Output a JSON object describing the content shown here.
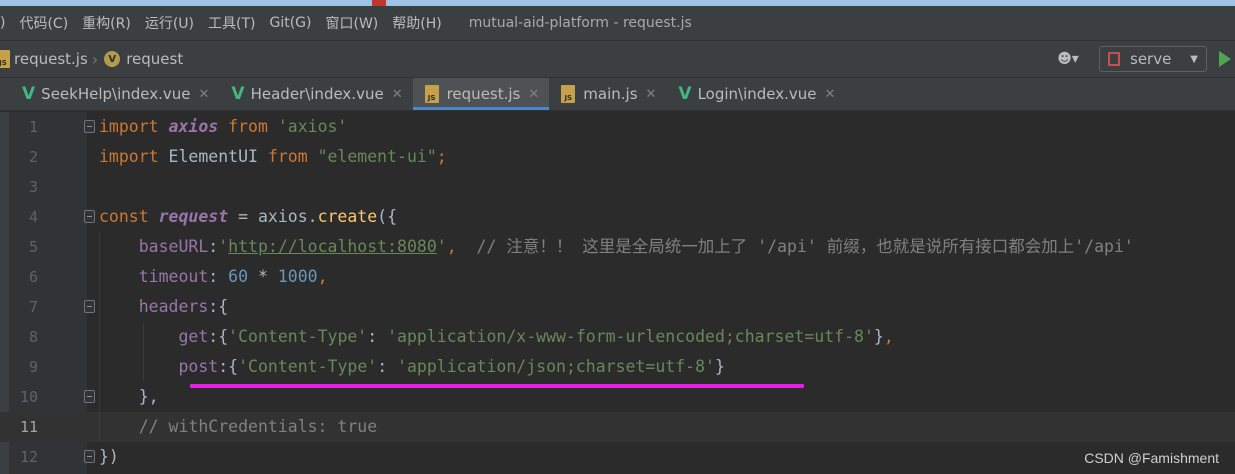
{
  "menubar": {
    "items": [
      "代码(C)",
      "重构(R)",
      "运行(U)",
      "工具(T)",
      "Git(G)",
      "窗口(W)",
      "帮助(H)"
    ],
    "window_title": "mutual-aid-platform - request.js"
  },
  "breadcrumb": {
    "file": "request.js",
    "symbol": "request",
    "symbol_badge": "V"
  },
  "toolbar": {
    "run_config": "serve"
  },
  "tabs": [
    {
      "label": "SeekHelp\\index.vue",
      "icon": "vue-icon",
      "active": false
    },
    {
      "label": "Header\\index.vue",
      "icon": "vue-icon",
      "active": false
    },
    {
      "label": "request.js",
      "icon": "js-file-icon",
      "active": true
    },
    {
      "label": "main.js",
      "icon": "js-file-icon",
      "active": false
    },
    {
      "label": "Login\\index.vue",
      "icon": "vue-icon",
      "active": false
    }
  ],
  "editor": {
    "current_line": 11,
    "line_numbers": [
      "1",
      "2",
      "3",
      "4",
      "5",
      "6",
      "7",
      "8",
      "9",
      "10",
      "11",
      "12"
    ],
    "lines": [
      [
        {
          "t": "kw",
          "v": "import "
        },
        {
          "t": "var-i",
          "v": "axios"
        },
        {
          "t": "kw",
          "v": " from "
        },
        {
          "t": "str",
          "v": "'axios'"
        }
      ],
      [
        {
          "t": "kw",
          "v": "import "
        },
        {
          "t": "plain",
          "v": "ElementUI"
        },
        {
          "t": "kw",
          "v": " from "
        },
        {
          "t": "str",
          "v": "\"element-ui\""
        },
        {
          "t": "kw",
          "v": ";"
        }
      ],
      [],
      [
        {
          "t": "kw",
          "v": "const "
        },
        {
          "t": "var-i",
          "v": "request"
        },
        {
          "t": "plain",
          "v": " = axios."
        },
        {
          "t": "fn",
          "v": "create"
        },
        {
          "t": "plain",
          "v": "({"
        }
      ],
      [
        {
          "t": "plain",
          "v": "    "
        },
        {
          "t": "prop",
          "v": "baseURL"
        },
        {
          "t": "plain",
          "v": ":"
        },
        {
          "t": "str",
          "v": "'"
        },
        {
          "t": "url",
          "v": "http://localhost:8080"
        },
        {
          "t": "str",
          "v": "'"
        },
        {
          "t": "kw",
          "v": ","
        },
        {
          "t": "plain",
          "v": "  "
        },
        {
          "t": "cmt",
          "v": "// 注意！！ 这里是全局统一加上了 '/api' 前缀，也就是说所有接口都会加上'/api'"
        }
      ],
      [
        {
          "t": "plain",
          "v": "    "
        },
        {
          "t": "prop",
          "v": "timeout"
        },
        {
          "t": "plain",
          "v": ": "
        },
        {
          "t": "num-lit",
          "v": "60"
        },
        {
          "t": "plain",
          "v": " * "
        },
        {
          "t": "num-lit",
          "v": "1000"
        },
        {
          "t": "kw",
          "v": ","
        }
      ],
      [
        {
          "t": "plain",
          "v": "    "
        },
        {
          "t": "prop",
          "v": "headers"
        },
        {
          "t": "plain",
          "v": ":{"
        }
      ],
      [
        {
          "t": "plain",
          "v": "        "
        },
        {
          "t": "prop",
          "v": "get"
        },
        {
          "t": "plain",
          "v": ":{"
        },
        {
          "t": "str",
          "v": "'Content-Type'"
        },
        {
          "t": "plain",
          "v": ": "
        },
        {
          "t": "str",
          "v": "'application/x-www-form-urlencoded;charset=utf-8'"
        },
        {
          "t": "plain",
          "v": "}"
        },
        {
          "t": "kw",
          "v": ","
        }
      ],
      [
        {
          "t": "plain",
          "v": "        "
        },
        {
          "t": "prop",
          "v": "post"
        },
        {
          "t": "plain",
          "v": ":{"
        },
        {
          "t": "str",
          "v": "'Content-Type'"
        },
        {
          "t": "plain",
          "v": ": "
        },
        {
          "t": "str",
          "v": "'application/json;charset=utf-8'"
        },
        {
          "t": "plain",
          "v": "}"
        }
      ],
      [
        {
          "t": "plain",
          "v": "    },"
        }
      ],
      [
        {
          "t": "plain",
          "v": "    "
        },
        {
          "t": "cmt",
          "v": "// withCredentials: true"
        }
      ],
      [
        {
          "t": "plain",
          "v": "})"
        }
      ]
    ]
  },
  "watermark": "CSDN @Famishment",
  "colors": {
    "keyword": "#cc7832",
    "string": "#6a8759",
    "number": "#6897bb",
    "property": "#9876aa",
    "comment": "#808080",
    "annotation_underline": "#e91ee6"
  }
}
